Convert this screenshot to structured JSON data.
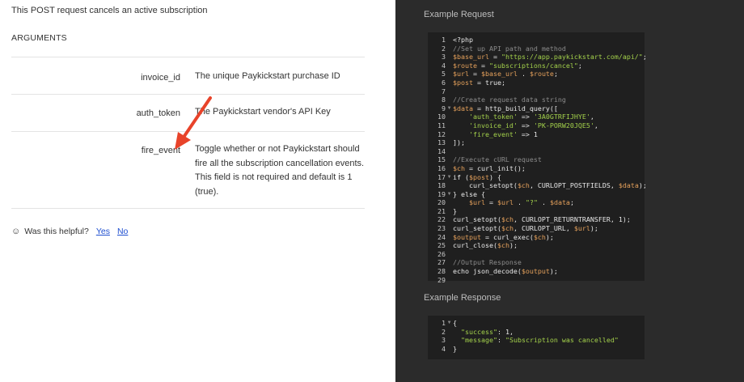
{
  "left": {
    "intro": "This POST request cancels an active subscription",
    "arguments_title": "ARGUMENTS",
    "arguments": [
      {
        "name": "invoice_id",
        "desc": "The unique Paykickstart purchase ID"
      },
      {
        "name": "auth_token",
        "desc": "The Paykickstart vendor's API Key"
      },
      {
        "name": "fire_event",
        "desc": "Toggle whether or not Paykickstart should fire all the subscription cancellation events. This field is not required and default is 1 (true)."
      }
    ],
    "helpful": {
      "label": "Was this helpful?",
      "yes": "Yes",
      "no": "No"
    }
  },
  "right": {
    "request_title": "Example Request",
    "response_title": "Example Response",
    "request_lines": [
      "<?php",
      "//Set up API path and method",
      "$base_url = \"https://app.paykickstart.com/api/\";",
      "$route = \"subscriptions/cancel\";",
      "$url = $base_url . $route;",
      "$post = true;",
      "",
      "//Create request data string",
      "$data = http_build_query([",
      "    'auth_token' => '3A0GTRFIJHYE',",
      "    'invoice_id' => 'PK-PORW20JQE5',",
      "    'fire_event' => 1",
      "]);",
      "",
      "//Execute cURL request",
      "$ch = curl_init();",
      "if ($post) {",
      "    curl_setopt($ch, CURLOPT_POSTFIELDS, $data);",
      "} else {",
      "    $url = $url . \"?\" . $data;",
      "}",
      "curl_setopt($ch, CURLOPT_RETURNTRANSFER, 1);",
      "curl_setopt($ch, CURLOPT_URL, $url);",
      "$output = curl_exec($ch);",
      "curl_close($ch);",
      "",
      "//Output Response",
      "echo json_decode($output);",
      ""
    ],
    "request_folds": [
      9,
      17,
      19
    ],
    "response_lines": [
      "{",
      "  \"success\": 1,",
      "  \"message\": \"Subscription was cancelled\"",
      "}"
    ],
    "response_folds": [
      1
    ]
  }
}
